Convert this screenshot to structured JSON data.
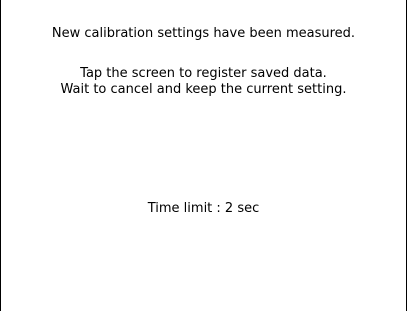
{
  "calibration": {
    "line_measured": "New calibration settings have been measured.",
    "line_tap": "Tap the screen to register saved data.",
    "line_wait": "Wait to cancel and keep the current setting.",
    "time_limit": "Time limit : 2 sec"
  }
}
